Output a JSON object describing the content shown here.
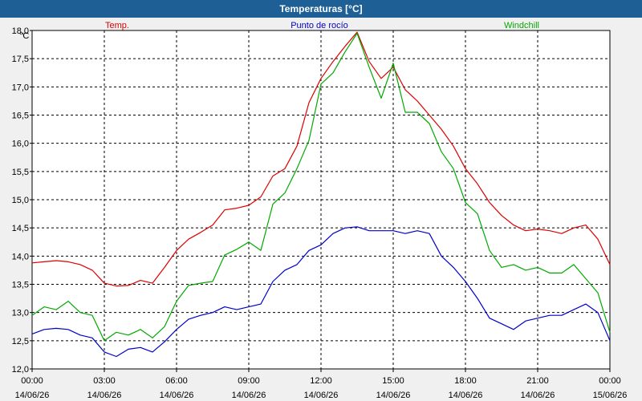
{
  "window": {
    "title": "Temperaturas [°C]"
  },
  "colors": {
    "titlebar": "#1e5f95",
    "temp": "#dd0000",
    "dew": "#0000cc",
    "wind": "#00aa00",
    "grid": "#000000"
  },
  "chart_data": {
    "type": "line",
    "title": "Temperaturas [°C]",
    "ylabel": "°C",
    "xlabel": "",
    "ylim": [
      12.0,
      18.0
    ],
    "yticks": [
      "12,0",
      "12,5",
      "13,0",
      "13,5",
      "14,0",
      "14,5",
      "15,0",
      "15,5",
      "16,0",
      "16,5",
      "17,0",
      "17,5",
      "18,0"
    ],
    "xlim_hours": [
      0,
      24
    ],
    "xticks": [
      {
        "time": "00:00",
        "date": "14/06/26"
      },
      {
        "time": "03:00",
        "date": "14/06/26"
      },
      {
        "time": "06:00",
        "date": "14/06/26"
      },
      {
        "time": "09:00",
        "date": "14/06/26"
      },
      {
        "time": "12:00",
        "date": "14/06/26"
      },
      {
        "time": "15:00",
        "date": "14/06/26"
      },
      {
        "time": "18:00",
        "date": "14/06/26"
      },
      {
        "time": "21:00",
        "date": "14/06/26"
      },
      {
        "time": "00:00",
        "date": "15/06/26"
      }
    ],
    "grid": true,
    "legend_position": "top",
    "x_hours": [
      0,
      0.5,
      1,
      1.5,
      2,
      2.5,
      3,
      3.5,
      4,
      4.5,
      5,
      5.5,
      6,
      6.5,
      7,
      7.5,
      8,
      8.5,
      9,
      9.5,
      10,
      10.5,
      11,
      11.5,
      12,
      12.5,
      13,
      13.5,
      14,
      14.5,
      15,
      15.5,
      16,
      16.5,
      17,
      17.5,
      18,
      18.5,
      19,
      19.5,
      20,
      20.5,
      21,
      21.5,
      22,
      22.5,
      23,
      23.5,
      24
    ],
    "series": [
      {
        "name": "Temp.",
        "color": "#dd0000",
        "values": [
          13.88,
          13.9,
          13.92,
          13.9,
          13.85,
          13.75,
          13.52,
          13.47,
          13.48,
          13.57,
          13.52,
          13.8,
          14.1,
          14.3,
          14.42,
          14.55,
          14.82,
          14.85,
          14.9,
          15.05,
          15.42,
          15.55,
          15.95,
          16.72,
          17.15,
          17.45,
          17.72,
          17.97,
          17.45,
          17.15,
          17.35,
          16.95,
          16.75,
          16.5,
          16.25,
          15.95,
          15.55,
          15.28,
          14.95,
          14.72,
          14.55,
          14.45,
          14.48,
          14.45,
          14.4,
          14.5,
          14.55,
          14.3,
          13.85
        ]
      },
      {
        "name": "Punto de rocío",
        "color": "#0000cc",
        "values": [
          12.62,
          12.7,
          12.72,
          12.7,
          12.6,
          12.55,
          12.3,
          12.22,
          12.35,
          12.38,
          12.3,
          12.48,
          12.7,
          12.88,
          12.95,
          13.0,
          13.1,
          13.05,
          13.1,
          13.15,
          13.55,
          13.75,
          13.85,
          14.1,
          14.2,
          14.4,
          14.5,
          14.52,
          14.45,
          14.45,
          14.45,
          14.4,
          14.45,
          14.4,
          14.0,
          13.8,
          13.55,
          13.25,
          12.9,
          12.8,
          12.7,
          12.85,
          12.9,
          12.95,
          12.95,
          13.05,
          13.15,
          13.0,
          12.5
        ]
      },
      {
        "name": "Windchill",
        "color": "#00aa00",
        "values": [
          12.95,
          13.1,
          13.05,
          13.2,
          13.0,
          12.95,
          12.5,
          12.65,
          12.6,
          12.7,
          12.55,
          12.75,
          13.2,
          13.48,
          13.52,
          13.55,
          14.02,
          14.12,
          14.25,
          14.1,
          14.92,
          15.12,
          15.55,
          16.05,
          17.05,
          17.25,
          17.62,
          17.95,
          17.35,
          16.8,
          17.42,
          16.55,
          16.55,
          16.35,
          15.85,
          15.55,
          14.95,
          14.75,
          14.1,
          13.8,
          13.85,
          13.75,
          13.8,
          13.7,
          13.7,
          13.85,
          13.6,
          13.35,
          12.65
        ]
      }
    ]
  }
}
